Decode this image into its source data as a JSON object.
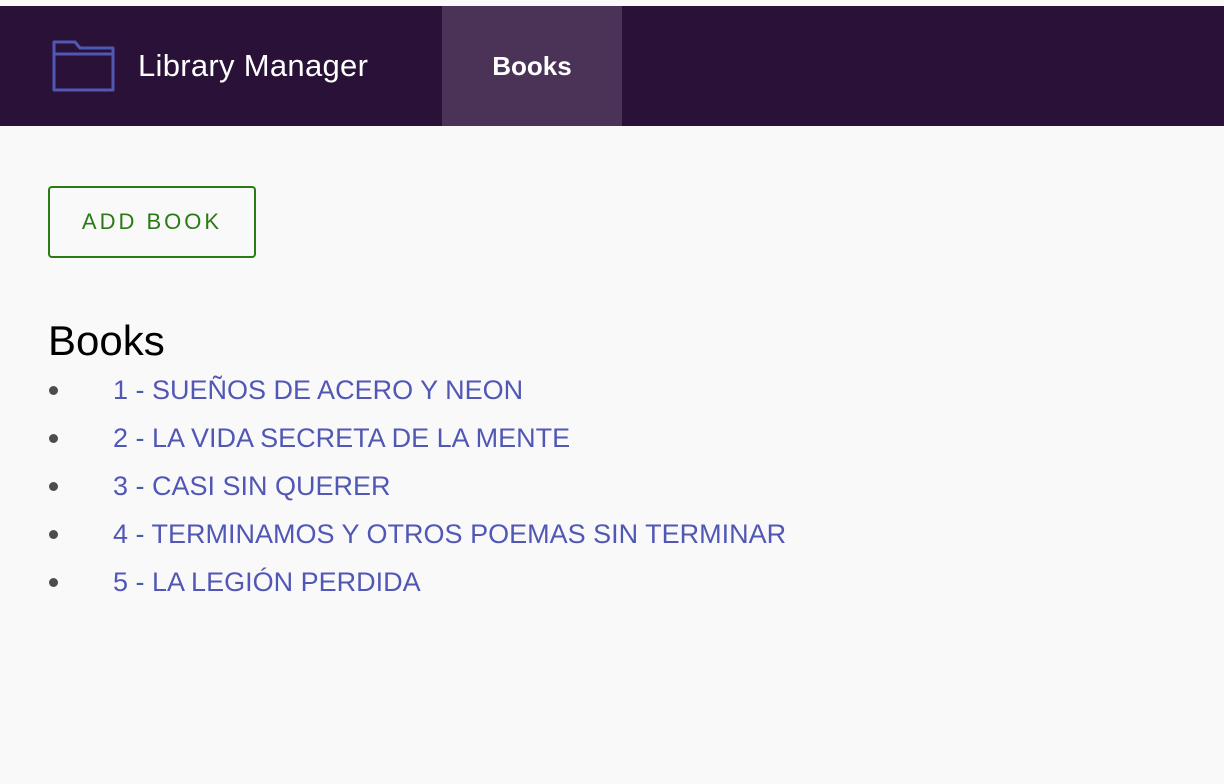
{
  "app": {
    "title": "Library Manager",
    "icon": "folder-icon"
  },
  "nav": {
    "tabs": [
      {
        "label": "Books",
        "active": true
      }
    ]
  },
  "actions": {
    "add_book_label": "ADD BOOK"
  },
  "main": {
    "section_title": "Books",
    "books": [
      {
        "label": "1 - SUEÑOS DE ACERO Y NEON"
      },
      {
        "label": "2 - LA VIDA SECRETA DE LA MENTE"
      },
      {
        "label": "3 - CASI SIN QUERER"
      },
      {
        "label": "4 - TERMINAMOS Y OTROS POEMAS SIN TERMINAR"
      },
      {
        "label": "5 - LA LEGIÓN PERDIDA"
      }
    ]
  },
  "colors": {
    "navbar_bg": "#291137",
    "active_tab_bg": "#4a3356",
    "icon_stroke": "#5157b5",
    "link": "#5157b5",
    "button_accent": "#2a7a17",
    "page_bg": "#f9f9f9"
  }
}
